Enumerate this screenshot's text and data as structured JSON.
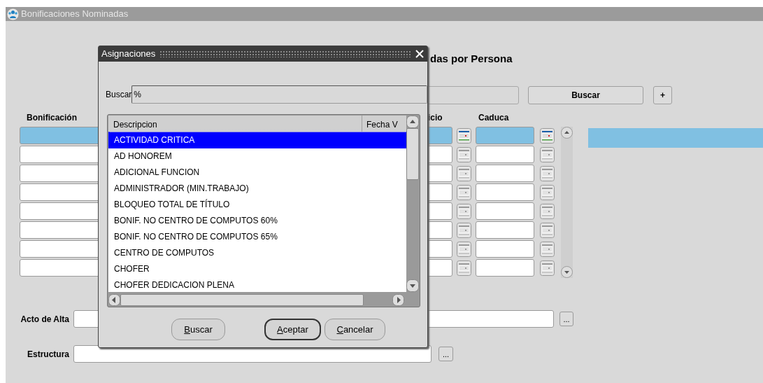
{
  "window": {
    "title": "Bonificaciones Nominadas"
  },
  "form": {
    "heading": "das por Persona",
    "search_button": "Buscar",
    "add_button": "+",
    "columns": [
      "Bonificación",
      "icio",
      "Caduca"
    ],
    "rows": [
      {
        "current": true
      },
      {
        "current": false
      },
      {
        "current": false
      },
      {
        "current": false
      },
      {
        "current": false
      },
      {
        "current": false
      },
      {
        "current": false
      },
      {
        "current": false
      }
    ],
    "fields": [
      {
        "label": "Acto de Alta",
        "button": "..."
      },
      {
        "label": "Estructura",
        "button": "..."
      }
    ]
  },
  "dialog": {
    "title": "Asignaciones",
    "search_label": "Buscar",
    "search_value": "%",
    "columns": [
      "Descripcion",
      "Fecha V"
    ],
    "items": [
      {
        "label": "ACTIVIDAD CRITICA",
        "selected": true
      },
      {
        "label": "AD HONOREM",
        "selected": false
      },
      {
        "label": "ADICIONAL FUNCION",
        "selected": false
      },
      {
        "label": "ADMINISTRADOR (MIN.TRABAJO)",
        "selected": false
      },
      {
        "label": "BLOQUEO TOTAL DE TÍTULO",
        "selected": false
      },
      {
        "label": "BONIF. NO CENTRO DE COMPUTOS 60%",
        "selected": false
      },
      {
        "label": "BONIF. NO CENTRO DE COMPUTOS 65%",
        "selected": false
      },
      {
        "label": "CENTRO DE COMPUTOS",
        "selected": false
      },
      {
        "label": "CHOFER",
        "selected": false
      },
      {
        "label": "CHOFER DEDICACION PLENA",
        "selected": false
      }
    ],
    "buttons": [
      {
        "label": "Buscar",
        "default": false
      },
      {
        "label": "Aceptar",
        "default": true
      },
      {
        "label": "Cancelar",
        "default": false
      }
    ]
  }
}
